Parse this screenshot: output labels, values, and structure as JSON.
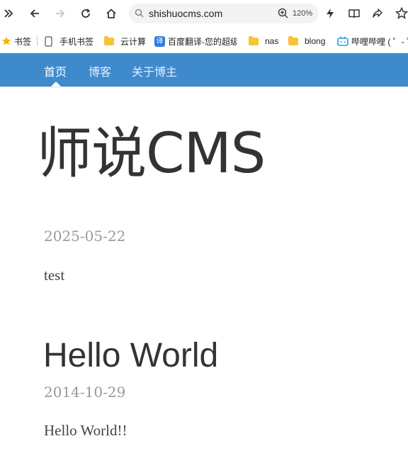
{
  "browser": {
    "url": "shishuocms.com",
    "zoom": "120%",
    "bookmarks": [
      {
        "label": "书签",
        "icon": "star-icon"
      },
      {
        "label": "手机书签",
        "icon": "phone-icon"
      },
      {
        "label": "云计算",
        "icon": "folder-icon"
      },
      {
        "label": "百度翻译-您的超级",
        "icon": "translate-icon"
      },
      {
        "label": "nas",
        "icon": "folder-icon"
      },
      {
        "label": "blong",
        "icon": "folder-icon"
      },
      {
        "label": "哔哩哔哩 ( ゜- ゜",
        "icon": "bilibili-icon"
      }
    ],
    "translate_badge": "译"
  },
  "nav": {
    "items": [
      {
        "label": "首页",
        "active": true
      },
      {
        "label": "博客",
        "active": false
      },
      {
        "label": "关于博主",
        "active": false
      }
    ],
    "color": "#3f8acc"
  },
  "site": {
    "title": "师说CMS"
  },
  "posts": [
    {
      "title": "",
      "date": "2025-05-22",
      "body": "test"
    },
    {
      "title": "Hello World",
      "date": "2014-10-29",
      "body": "Hello World!!"
    }
  ]
}
